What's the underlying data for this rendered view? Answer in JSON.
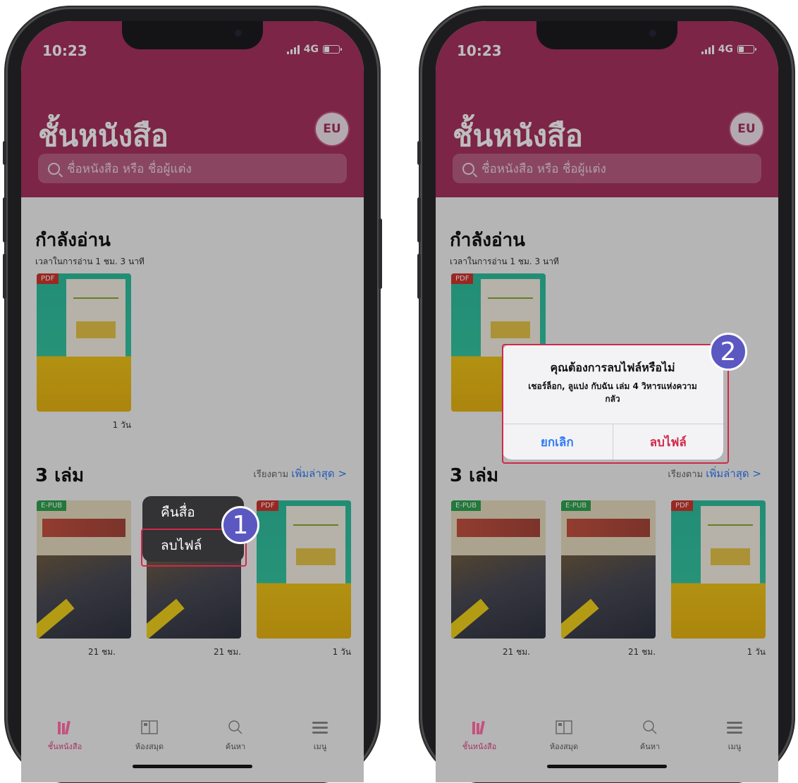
{
  "status": {
    "time": "10:23",
    "network": "4G"
  },
  "header": {
    "title": "ชั้นหนังสือ",
    "badge": "EU",
    "search_placeholder": "ชื่อหนังสือ หรือ ชื่อผู้แต่ง"
  },
  "reading": {
    "title": "กำลังอ่าน",
    "subtitle": "เวลาในการอ่าน 1 ชม. 3 นาที",
    "book_badge": "PDF",
    "book_duration": "1 วัน"
  },
  "library": {
    "title": "3 เล่ม",
    "sort_label": "เรียงตาม",
    "sort_value": "เพิ่มล่าสุด >",
    "books": [
      {
        "badge": "E-PUB",
        "duration": "21 ชม."
      },
      {
        "badge": "E-PUB",
        "duration": "21 ชม."
      },
      {
        "badge": "PDF",
        "duration": "1 วัน"
      }
    ]
  },
  "context_menu": {
    "items": [
      "คืนสื่อ",
      "ลบไฟล์"
    ]
  },
  "alert": {
    "title": "คุณต้องการลบไฟล์หรือไม่",
    "message": "เชอร์ล็อก, ลูแปง กับฉัน เล่ม 4 วิหารแห่งความกลัว",
    "cancel": "ยกเลิก",
    "delete": "ลบไฟล์"
  },
  "steps": [
    "1",
    "2"
  ],
  "tabbar": {
    "items": [
      "ชั้นหนังสือ",
      "ห้องสมุด",
      "ค้นหา",
      "เมนู"
    ]
  },
  "colors": {
    "brand": "#a8325f",
    "link": "#2f7bf6",
    "danger": "#d0294a",
    "step": "#5b58c2"
  }
}
